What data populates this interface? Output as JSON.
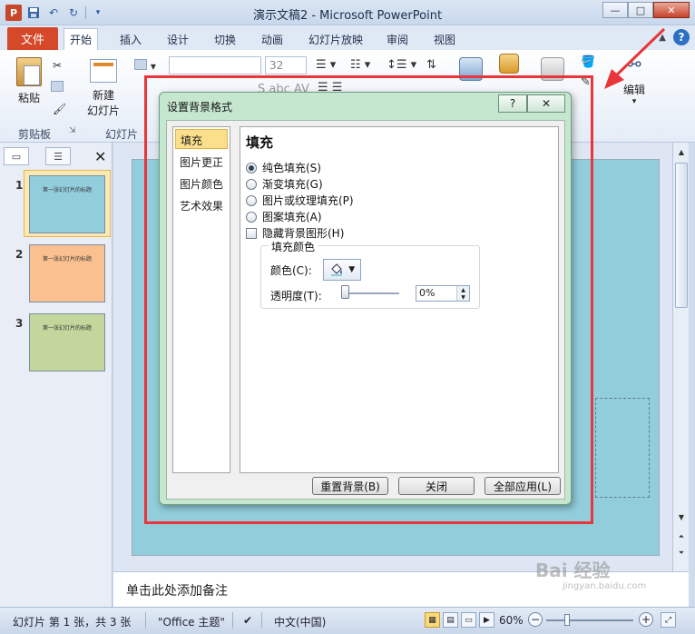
{
  "window": {
    "title": "演示文稿2 - Microsoft PowerPoint",
    "app_icon_letter": "P",
    "controls": {
      "minimize": "—",
      "maximize": "□",
      "close": "✕"
    }
  },
  "ribbon": {
    "file_tab": "文件",
    "tabs": [
      "开始",
      "插入",
      "设计",
      "切换",
      "动画",
      "幻灯片放映",
      "审阅",
      "视图"
    ],
    "active_tab": "开始",
    "help_symbol": "?",
    "groups": {
      "clipboard": {
        "paste": "粘贴",
        "label": "剪贴板"
      },
      "slides": {
        "new_slide_line1": "新建",
        "new_slide_line2": "幻灯片",
        "label": "幻灯片"
      },
      "font": {
        "size": "32"
      },
      "editing": {
        "label": "编辑"
      }
    }
  },
  "slides_pane": {
    "thumbnails": [
      {
        "number": "1",
        "text": "第一张幻灯片的标题",
        "color": "#92cddc",
        "selected": true
      },
      {
        "number": "2",
        "text": "第一张幻灯片的标题",
        "color": "#fac090",
        "selected": false
      },
      {
        "number": "3",
        "text": "第一张幻灯片的标题",
        "color": "#c3d69b",
        "selected": false
      }
    ]
  },
  "notes": {
    "placeholder": "单击此处添加备注"
  },
  "status": {
    "slide_info": "幻灯片 第 1 张，共 3 张",
    "theme": "\"Office 主题\"",
    "language": "中文(中国)",
    "zoom": "60%"
  },
  "dialog": {
    "title": "设置背景格式",
    "help": "?",
    "close": "✕",
    "categories": [
      "填充",
      "图片更正",
      "图片颜色",
      "艺术效果"
    ],
    "selected_category": "填充",
    "heading": "填充",
    "options": [
      {
        "label": "纯色填充(S)",
        "checked": true
      },
      {
        "label": "渐变填充(G)",
        "checked": false
      },
      {
        "label": "图片或纹理填充(P)",
        "checked": false
      },
      {
        "label": "图案填充(A)",
        "checked": false
      }
    ],
    "hide_graphics": {
      "label": "隐藏背景图形(H)",
      "checked": false
    },
    "fill_color": {
      "legend": "填充颜色",
      "color_label": "颜色(C):",
      "transparency_label": "透明度(T):",
      "transparency_value": "0%",
      "transparency_fraction": 0
    },
    "buttons": {
      "reset": "重置背景(B)",
      "close": "关闭",
      "apply_all": "全部应用(L)"
    }
  },
  "colors": {
    "accent_file_tab": "#d5482a",
    "annotation_red": "#e8363a",
    "slide_background": "#92cddc"
  },
  "watermark": {
    "main": "Bai 经验",
    "sub": "jingyan.baidu.com"
  }
}
